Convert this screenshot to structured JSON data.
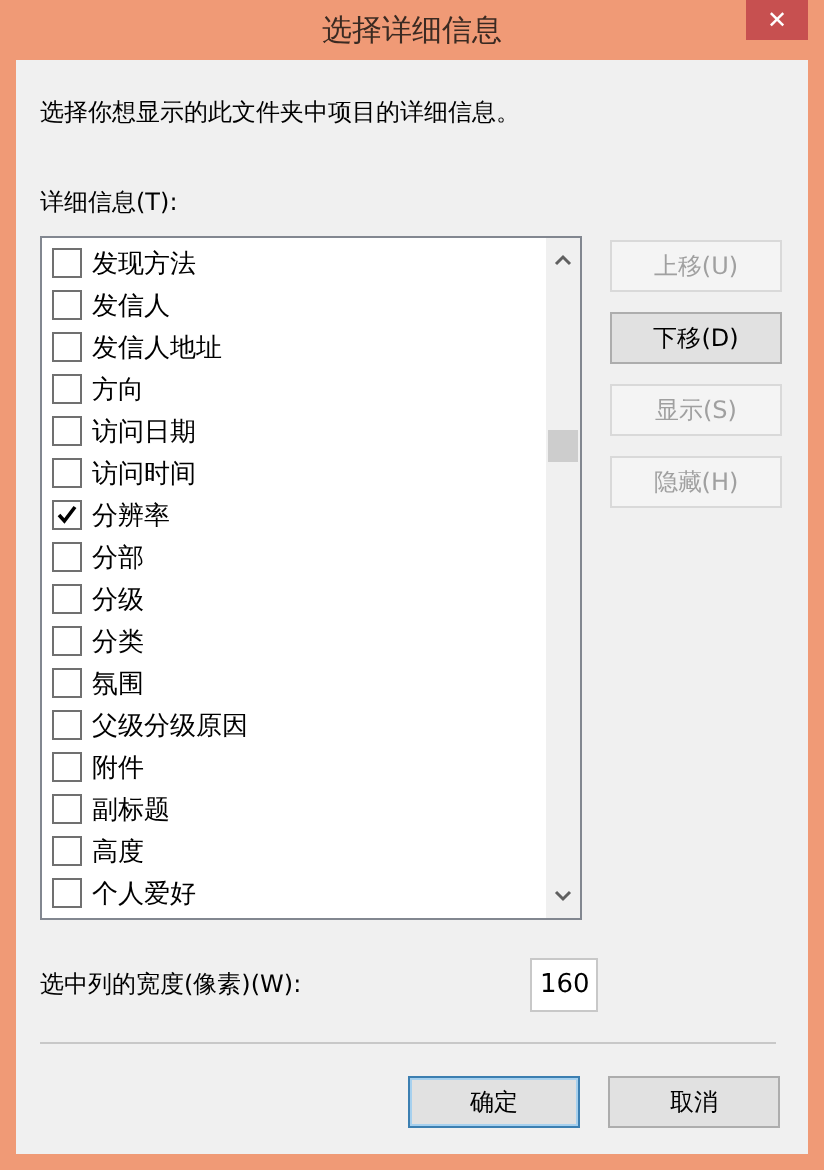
{
  "window": {
    "title": "选择详细信息",
    "close": "✕"
  },
  "instruction": "选择你想显示的此文件夹中项目的详细信息。",
  "details_label": "详细信息(T):",
  "details": [
    {
      "label": "发现方法",
      "checked": false
    },
    {
      "label": "发信人",
      "checked": false
    },
    {
      "label": "发信人地址",
      "checked": false
    },
    {
      "label": "方向",
      "checked": false
    },
    {
      "label": "访问日期",
      "checked": false
    },
    {
      "label": "访问时间",
      "checked": false
    },
    {
      "label": "分辨率",
      "checked": true
    },
    {
      "label": "分部",
      "checked": false
    },
    {
      "label": "分级",
      "checked": false
    },
    {
      "label": "分类",
      "checked": false
    },
    {
      "label": "氛围",
      "checked": false
    },
    {
      "label": "父级分级原因",
      "checked": false
    },
    {
      "label": "附件",
      "checked": false
    },
    {
      "label": "副标题",
      "checked": false
    },
    {
      "label": "高度",
      "checked": false
    },
    {
      "label": "个人爱好",
      "checked": false
    }
  ],
  "side_buttons": [
    {
      "label": "上移(U)",
      "disabled": true
    },
    {
      "label": "下移(D)",
      "disabled": false
    },
    {
      "label": "显示(S)",
      "disabled": true
    },
    {
      "label": "隐藏(H)",
      "disabled": true
    }
  ],
  "width_label": "选中列的宽度(像素)(W):",
  "width_value": "160",
  "footer_buttons": [
    {
      "label": "确定",
      "default": true
    },
    {
      "label": "取消",
      "default": false
    }
  ]
}
